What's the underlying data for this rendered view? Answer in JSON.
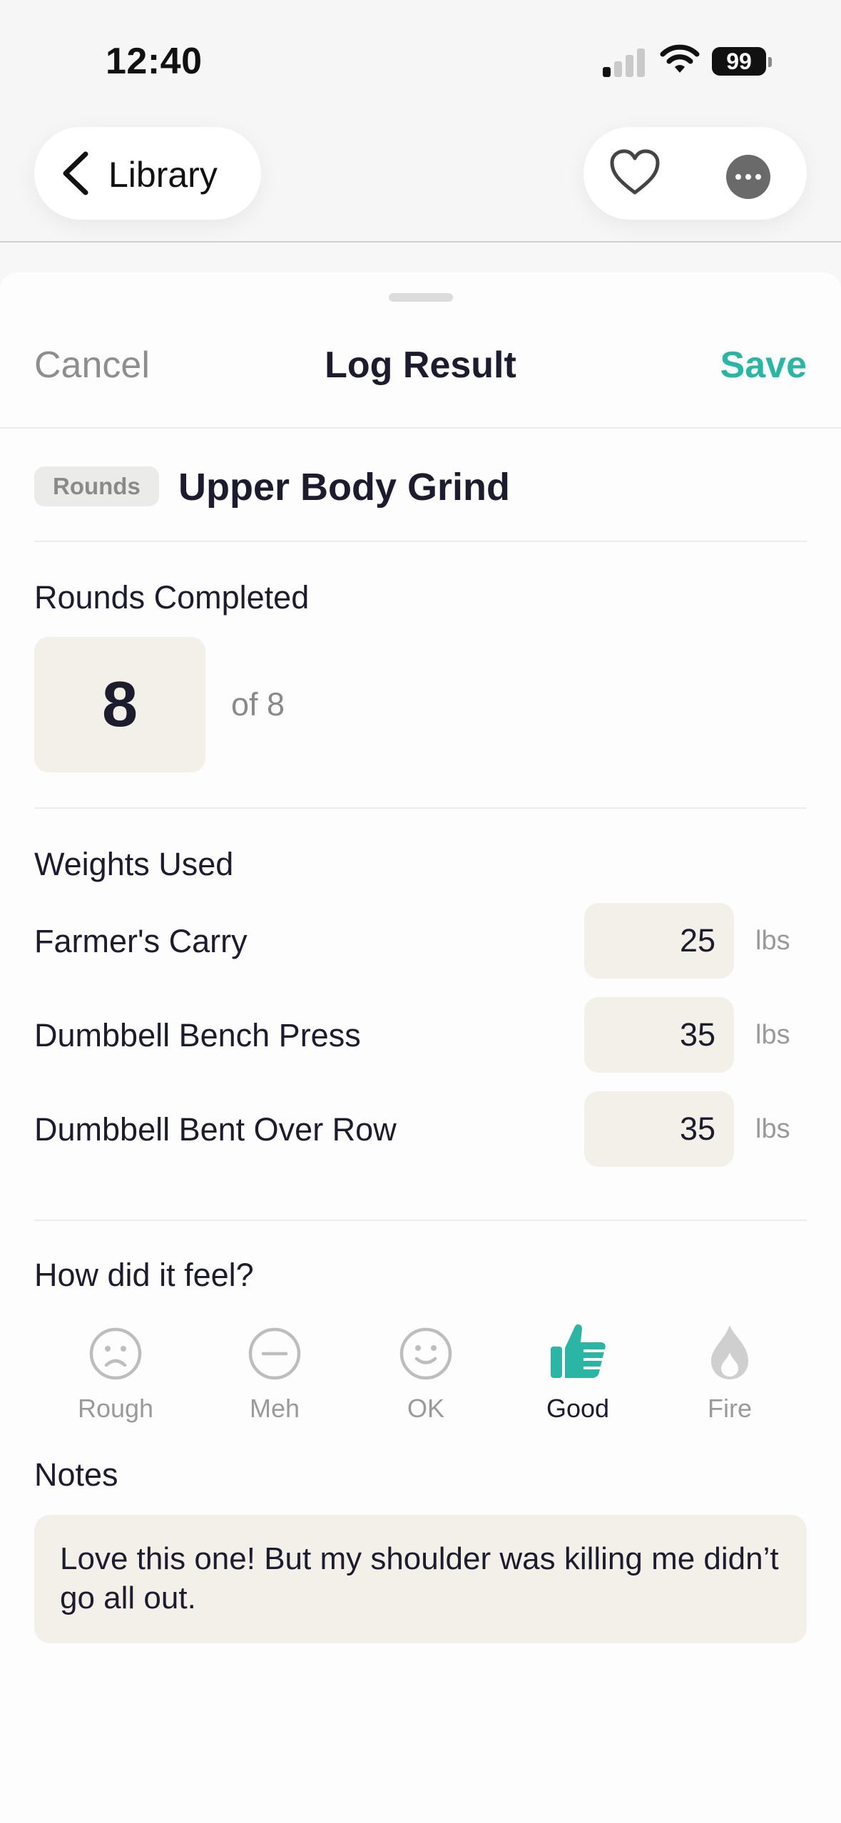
{
  "status_bar": {
    "time": "12:40",
    "battery": "99"
  },
  "nav": {
    "back_label": "Library"
  },
  "sheet": {
    "cancel_label": "Cancel",
    "title": "Log Result",
    "save_label": "Save"
  },
  "workout": {
    "type_badge": "Rounds",
    "name": "Upper Body Grind"
  },
  "rounds": {
    "section_title": "Rounds Completed",
    "completed": "8",
    "of_total": "of 8"
  },
  "weights": {
    "section_title": "Weights Used",
    "items": [
      {
        "name": "Farmer's Carry",
        "value": "25",
        "unit": "lbs"
      },
      {
        "name": "Dumbbell Bench Press",
        "value": "35",
        "unit": "lbs"
      },
      {
        "name": "Dumbbell Bent Over Row",
        "value": "35",
        "unit": "lbs"
      }
    ]
  },
  "feel": {
    "section_title": "How did it feel?",
    "options": [
      {
        "label": "Rough",
        "icon": "sad-face-icon"
      },
      {
        "label": "Meh",
        "icon": "neutral-face-icon"
      },
      {
        "label": "OK",
        "icon": "smile-face-icon"
      },
      {
        "label": "Good",
        "icon": "thumbs-up-icon"
      },
      {
        "label": "Fire",
        "icon": "flame-icon"
      }
    ],
    "selected": "Good"
  },
  "notes": {
    "section_title": "Notes",
    "text": "Love this one! But my shoulder was killing me didn’t go all out."
  },
  "colors": {
    "accent": "#2ab5a5",
    "field_bg": "#f3efe9",
    "muted_text": "#8a8a8a"
  }
}
